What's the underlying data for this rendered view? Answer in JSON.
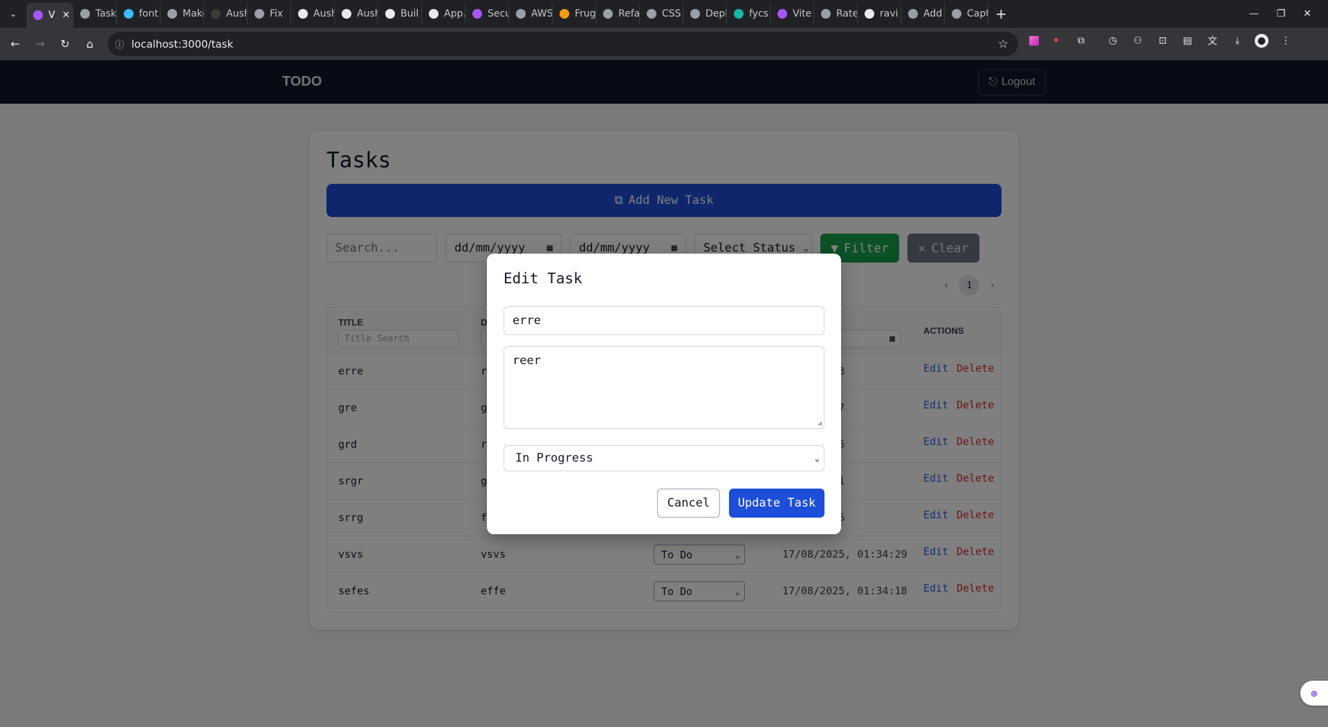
{
  "browser": {
    "tabs": [
      {
        "label": "V",
        "active": true
      },
      {
        "label": "Task"
      },
      {
        "label": "font"
      },
      {
        "label": "Make"
      },
      {
        "label": "Aush"
      },
      {
        "label": "Fix"
      },
      {
        "label": "Aush"
      },
      {
        "label": "Aush"
      },
      {
        "label": "Buil"
      },
      {
        "label": "App."
      },
      {
        "label": "Secu"
      },
      {
        "label": "AWS"
      },
      {
        "label": "Frug"
      },
      {
        "label": "Refa"
      },
      {
        "label": "CSS"
      },
      {
        "label": "Depl"
      },
      {
        "label": "fycs"
      },
      {
        "label": "Vite"
      },
      {
        "label": "Rate"
      },
      {
        "label": "ravi"
      },
      {
        "label": "Add"
      },
      {
        "label": "Capt"
      }
    ],
    "url": "localhost:3000/task"
  },
  "app": {
    "brand": "TODO",
    "logout_label": "Logout"
  },
  "page": {
    "title": "Tasks",
    "add_task_label": "Add New Task",
    "search_placeholder": "Search...",
    "date_from_placeholder": "dd/mm/yyyy",
    "date_to_placeholder": "dd/mm/yyyy",
    "status_select": "Select Status",
    "filter_label": "Filter",
    "clear_label": "Clear",
    "pagination": {
      "prev": "‹",
      "current": "1",
      "next": "›"
    }
  },
  "table": {
    "headers": {
      "title": "TITLE",
      "desc": "D",
      "actions": "ACTIONS"
    },
    "title_search_placeholder": "Title Search",
    "rows": [
      {
        "title": "erre",
        "desc": "r",
        "date": ", 01:43:33",
        "edit": "Edit",
        "delete": "Delete"
      },
      {
        "title": "gre",
        "desc": "g",
        "date": ", 01:43:27",
        "edit": "Edit",
        "delete": "Delete"
      },
      {
        "title": "grd",
        "desc": "r",
        "date": ", 01:43:15",
        "edit": "Edit",
        "delete": "Delete"
      },
      {
        "title": "srgr",
        "desc": "g",
        "date": ", 01:42:21",
        "edit": "Edit",
        "delete": "Delete"
      },
      {
        "title": "srrg",
        "desc": "f",
        "date": ", 01:42:15",
        "edit": "Edit",
        "delete": "Delete"
      },
      {
        "title": "vsvs",
        "desc": "vsvs",
        "status": "To Do",
        "date": "17/08/2025, 01:34:29",
        "edit": "Edit",
        "delete": "Delete"
      },
      {
        "title": "sefes",
        "desc": "effe",
        "status": "To Do",
        "date": "17/08/2025, 01:34:18",
        "edit": "Edit",
        "delete": "Delete"
      }
    ]
  },
  "modal": {
    "title": "Edit Task",
    "task_title": "erre",
    "task_description": "reer",
    "status": "In Progress",
    "cancel_label": "Cancel",
    "update_label": "Update Task"
  },
  "colors": {
    "primary": "#1d4ed8",
    "success": "#16a34a",
    "danger": "#dc2626",
    "nav": "#0f172a"
  }
}
